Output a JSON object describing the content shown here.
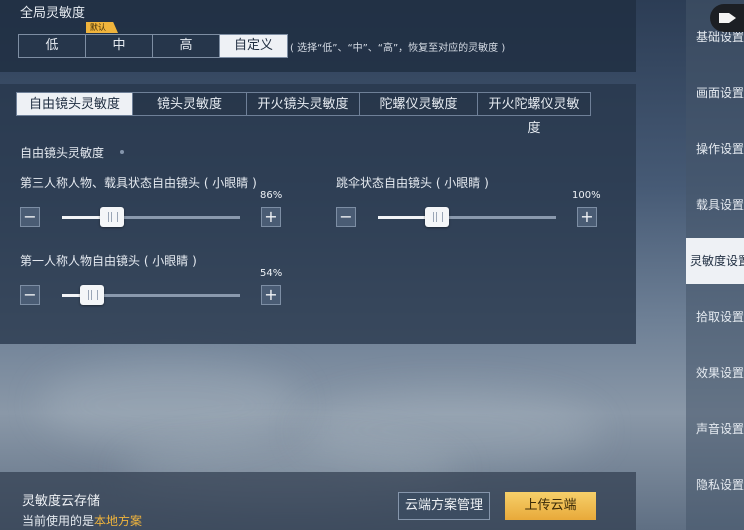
{
  "global": {
    "title": "全局灵敏度",
    "presets": [
      "低",
      "中",
      "高",
      "自定义"
    ],
    "active_preset": "自定义",
    "default_tag": "默认",
    "hint": "( 选择“低”、“中”、“高”，恢复至对应的灵敏度 )"
  },
  "tabs": [
    {
      "label": "自由镜头灵敏度",
      "active": true
    },
    {
      "label": "镜头灵敏度",
      "active": false
    },
    {
      "label": "开火镜头灵敏度",
      "active": false
    },
    {
      "label": "陀螺仪灵敏度",
      "active": false
    },
    {
      "label": "开火陀螺仪灵敏度",
      "active": false
    }
  ],
  "section": {
    "title": "自由镜头灵敏度"
  },
  "sliders": [
    {
      "label": "第三人称人物、载具状态自由镜头 ( 小眼睛 )",
      "value_text": "86%",
      "fraction": 0.28
    },
    {
      "label": "跳伞状态自由镜头 ( 小眼睛 )",
      "value_text": "100%",
      "fraction": 0.33
    },
    {
      "label": "第一人称人物自由镜头 ( 小眼睛 )",
      "value_text": "54%",
      "fraction": 0.17
    }
  ],
  "controls": {
    "minus": "−",
    "plus": "+"
  },
  "cloud": {
    "title": "灵敏度云存储",
    "current_prefix": "当前使用的是",
    "current_value": "本地方案",
    "manage_button": "云端方案管理",
    "upload_button": "上传云端"
  },
  "sidebar": {
    "items": [
      "基础设置",
      "画面设置",
      "操作设置",
      "载具设置",
      "灵敏度设置",
      "拾取设置",
      "效果设置",
      "声音设置",
      "隐私设置"
    ],
    "active": "灵敏度设置"
  },
  "colors": {
    "accent": "#f0b43c",
    "active_bg": "#eef1f5"
  }
}
